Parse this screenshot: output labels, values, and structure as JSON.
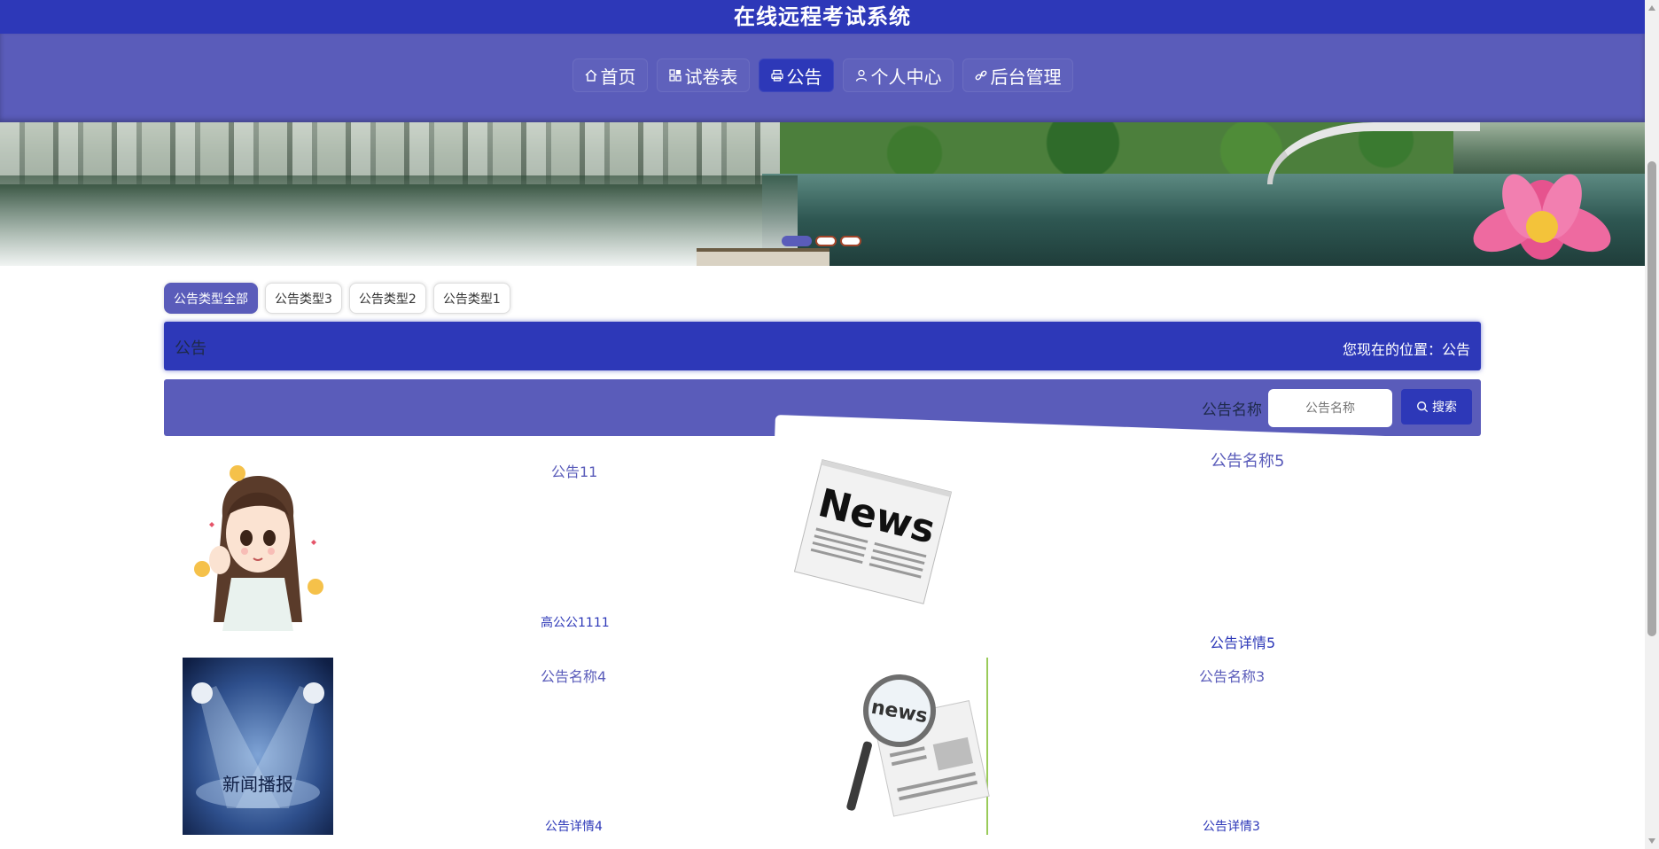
{
  "header": {
    "title": "在线远程考试系统"
  },
  "nav": {
    "items": [
      {
        "label": "首页",
        "icon": "home-icon"
      },
      {
        "label": "试卷表",
        "icon": "grid-icon"
      },
      {
        "label": "公告",
        "icon": "printer-icon",
        "active": true
      },
      {
        "label": "个人中心",
        "icon": "user-icon"
      },
      {
        "label": "后台管理",
        "icon": "link-icon"
      }
    ]
  },
  "categories": {
    "items": [
      {
        "label": "公告类型全部",
        "active": true
      },
      {
        "label": "公告类型3"
      },
      {
        "label": "公告类型2"
      },
      {
        "label": "公告类型1"
      }
    ]
  },
  "breadcrumb": {
    "title": "公告",
    "location": "您现在的位置：公告"
  },
  "search": {
    "label": "公告名称",
    "placeholder": "公告名称",
    "button": "搜索"
  },
  "news": [
    {
      "title": "公告11",
      "desc": "高公公1111",
      "image": "cartoon-girl"
    },
    {
      "title": "公告名称5",
      "desc": "公告详情5",
      "image": "news-paper"
    },
    {
      "title": "公告名称4",
      "desc": "公告详情4",
      "image": "spotlight-stage",
      "image_text": "新闻播报"
    },
    {
      "title": "公告名称3",
      "desc": "公告详情3",
      "image": "magnifier-news",
      "image_text": "news"
    }
  ],
  "colors": {
    "primary": "#2d38b8",
    "secondary": "#5a5cba",
    "link": "#5a5cba"
  }
}
